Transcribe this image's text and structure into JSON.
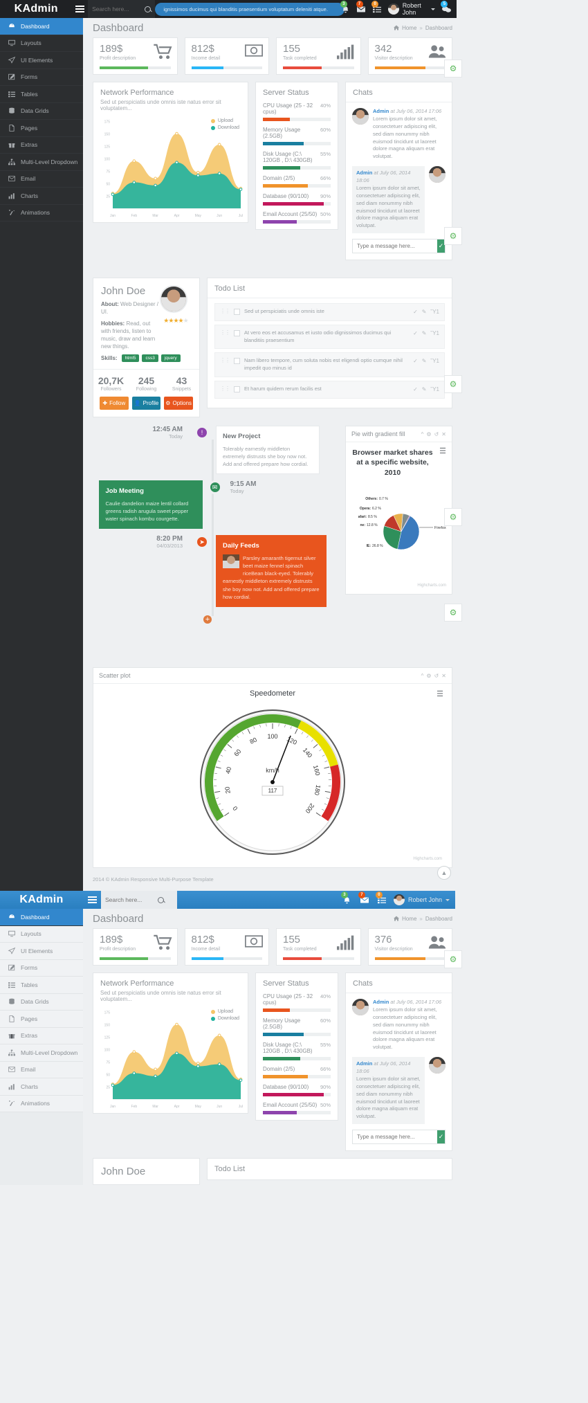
{
  "header": {
    "brand": "KAdmin",
    "search_placeholder": "Search here...",
    "ticker_text": "ignissimos ducimus qui blanditis praesentium voluptatum deleniti atque.",
    "bell_badge": "3",
    "mail_badge": "7",
    "tasks_badge": "0",
    "chat_badge": "5",
    "user_name": "Robert John"
  },
  "sidebar": {
    "items": [
      {
        "label": "Dashboard",
        "icon": "dashboard-icon",
        "active": true
      },
      {
        "label": "Layouts",
        "icon": "monitor-icon",
        "active": false
      },
      {
        "label": "UI Elements",
        "icon": "paper-plane-icon",
        "active": false
      },
      {
        "label": "Forms",
        "icon": "edit-icon",
        "active": false
      },
      {
        "label": "Tables",
        "icon": "table-icon",
        "active": false
      },
      {
        "label": "Data Grids",
        "icon": "database-icon",
        "active": false
      },
      {
        "label": "Pages",
        "icon": "file-icon",
        "active": false
      },
      {
        "label": "Extras",
        "icon": "gift-icon",
        "active": false
      },
      {
        "label": "Multi-Level Dropdown",
        "icon": "sitemap-icon",
        "active": false
      },
      {
        "label": "Email",
        "icon": "envelope-icon",
        "active": false
      },
      {
        "label": "Charts",
        "icon": "chart-icon",
        "active": false
      },
      {
        "label": "Animations",
        "icon": "magic-icon",
        "active": false
      }
    ]
  },
  "page": {
    "title": "Dashboard",
    "breadcrumb_home": "Home",
    "breadcrumb_sep": "»",
    "breadcrumb_current": "Dashboard"
  },
  "stats": [
    {
      "value": "189$",
      "label": "Profit description",
      "icon": "cart-icon",
      "bar_color": "#5cb85c",
      "bar_pct": "68"
    },
    {
      "value": "812$",
      "label": "Income detail",
      "icon": "money-icon",
      "bar_color": "#29b6f6",
      "bar_pct": "45"
    },
    {
      "value": "155",
      "label": "Task completed",
      "icon": "bars-icon",
      "bar_color": "#e84c3d",
      "bar_pct": "55"
    },
    {
      "value": "342",
      "label": "Visitor description",
      "icon": "users-icon",
      "bar_color": "#f0932b",
      "bar_pct": "72"
    }
  ],
  "stats_second": [
    {
      "value": "189$",
      "label": "Profit description",
      "icon": "cart-icon",
      "bar_color": "#5cb85c",
      "bar_pct": "68"
    },
    {
      "value": "812$",
      "label": "Income detail",
      "icon": "money-icon",
      "bar_color": "#29b6f6",
      "bar_pct": "45"
    },
    {
      "value": "155",
      "label": "Task completed",
      "icon": "bars-icon",
      "bar_color": "#e84c3d",
      "bar_pct": "55"
    },
    {
      "value": "376",
      "label": "Visitor description",
      "icon": "users-icon",
      "bar_color": "#f0932b",
      "bar_pct": "72"
    }
  ],
  "network": {
    "title": "Network Performance",
    "subtitle": "Sed ut perspiciatis unde omnis iste natus error sit voluptatem...",
    "legend": [
      {
        "label": "Upload",
        "color": "#f4c568"
      },
      {
        "label": "Download",
        "color": "#21b2a0"
      }
    ]
  },
  "server_status": {
    "title": "Server Status",
    "rows": [
      {
        "label": "CPU Usage (25 - 32 cpus)",
        "pct": "40%",
        "value": 40,
        "color": "#e8551e"
      },
      {
        "label": "Memory Usage (2.5GB)",
        "pct": "60%",
        "value": 60,
        "color": "#1a7fa0"
      },
      {
        "label": "Disk Usage (C:\\ 120GB , D:\\ 430GB)",
        "pct": "55%",
        "value": 55,
        "color": "#2f8f5b"
      },
      {
        "label": "Domain (2/5)",
        "pct": "66%",
        "value": 66,
        "color": "#f0932b"
      },
      {
        "label": "Database (90/100)",
        "pct": "90%",
        "value": 90,
        "color": "#c2185b"
      },
      {
        "label": "Email Account (25/50)",
        "pct": "50%",
        "value": 50,
        "color": "#8e44ad"
      }
    ]
  },
  "chats": {
    "title": "Chats",
    "messages": [
      {
        "author": "Admin",
        "time": "at July 06, 2014 17:06",
        "text": "Lorem ipsum dolor sit amet, consectetuer adipiscing elit, sed diam nonummy nibh euismod tincidunt ut laoreet dolore magna aliquam erat volutpat.",
        "side": "left"
      },
      {
        "author": "Admin",
        "time": "at July 06, 2014 18:06",
        "text": "Lorem ipsum dolor sit amet, consectetuer adipiscing elit, sed diam nonummy nibh euismod tincidunt ut laoreet dolore magna aliquam erat volutpat.",
        "side": "right"
      }
    ],
    "input_placeholder": "Type a message here...",
    "send_icon": "check-icon"
  },
  "profile": {
    "name": "John Doe",
    "about_label": "About:",
    "about_value": "Web Designer / UI.",
    "hobbies_label": "Hobbies:",
    "hobbies_value": "Read, out with friends, listen to music, draw and learn new things.",
    "skills_label": "Skills:",
    "skills": [
      "html5",
      "css3",
      "jquery"
    ],
    "rating_filled": 4,
    "rating_total": 5,
    "stats": [
      {
        "number": "20,7K",
        "label": "Followers"
      },
      {
        "number": "245",
        "label": "Following"
      },
      {
        "number": "43",
        "label": "Snippets"
      }
    ],
    "buttons": [
      {
        "label": "Follow",
        "color": "#ef8a32",
        "icon": "plus-circle-icon"
      },
      {
        "label": "Profile",
        "color": "#1a7fa0",
        "icon": "user-icon"
      },
      {
        "label": "Options",
        "color": "#e8551e",
        "icon": "cog-circle-icon"
      }
    ]
  },
  "todo": {
    "title": "Todo List",
    "items": [
      "Sed ut perspiciatis unde omnis iste",
      "At vero eos et accusamus et iusto odio dignissimos ducimus qui blanditiis praesentium",
      "Nam libero tempore, cum soluta nobis est eligendi optio cumque nihil impedit quo minus id",
      "Et harum quidem rerum facilis est"
    ],
    "action_icons": [
      "check-icon",
      "edit-icon",
      "trash-icon"
    ]
  },
  "timeline": [
    {
      "time": "12:45 AM",
      "day": "Today",
      "dot_color": "#8e44ad",
      "dot_icon": "!",
      "card_style": "white",
      "title": "New Project",
      "text": "Tolerably earnestly middleton extremely distrusts she boy now not. Add and offered prepare how cordial."
    },
    {
      "time": "9:15 AM",
      "day": "Today",
      "dot_color": "#2f8f5b",
      "dot_icon": "✉",
      "card_style": "green",
      "title": "Job Meeting",
      "text": "Caulie dandelion maize lentil collard greens radish arugula sweet pepper water spinach kombu courgette."
    },
    {
      "time": "8:20 PM",
      "day": "04/03/2013",
      "dot_color": "#e8551e",
      "dot_icon": "➤",
      "card_style": "red",
      "title": "Daily Feeds",
      "text": "Parsley amaranth tigernut silver beet maize fennel spinach riceBean black-eyed. Tolerably earnestly middleton extremely distrusts she boy now not. Add and offered prepare how cordial."
    }
  ],
  "pie_panel": {
    "header": "Pie with gradient fill",
    "header_actions": [
      "collapse-icon",
      "settings-icon",
      "refresh-icon",
      "close-icon"
    ],
    "credits": "Highcharts.com",
    "menu_icon": "hamburger-menu-icon"
  },
  "scatter_panel": {
    "header": "Scatter plot",
    "header_actions": [
      "collapse-icon",
      "settings-icon",
      "refresh-icon",
      "close-icon"
    ],
    "credits": "Highcharts.com",
    "menu_icon": "hamburger-menu-icon"
  },
  "footer": "2014 © KAdmin Responsive Multi-Purpose Template",
  "chart_data": [
    {
      "type": "area",
      "title": "Network Performance",
      "subtitle": "Sed ut perspiciatis unde omnis iste natus error sit voluptatem...",
      "categories": [
        "Jan",
        "Feb",
        "Mar",
        "Apr",
        "May",
        "Jun",
        "Jul"
      ],
      "xlabel": "",
      "ylabel": "",
      "ylim": [
        0,
        175
      ],
      "yticks": [
        25,
        50,
        75,
        100,
        125,
        150,
        175
      ],
      "grid": false,
      "legend_position": "top-right",
      "series": [
        {
          "name": "Upload",
          "color": "#f4c568",
          "values": [
            30,
            95,
            60,
            150,
            72,
            128,
            40
          ]
        },
        {
          "name": "Download",
          "color": "#21b2a0",
          "values": [
            28,
            52,
            46,
            92,
            66,
            70,
            38
          ]
        }
      ]
    },
    {
      "type": "pie",
      "title": "Browser market shares at a specific website, 2010",
      "credits": "Highcharts.com",
      "legend_position": "none",
      "labels": [
        "Firefox",
        "IE",
        "Chrome",
        "Safari",
        "Opera",
        "Others"
      ],
      "values": [
        45.0,
        26.8,
        12.8,
        8.5,
        6.2,
        0.7
      ],
      "value_labels": [
        "Firefox",
        "IE: 26.8 %",
        "ne: 12.8 %",
        "afari: 8.5 %",
        "Opera: 6.2 %",
        "Others: 0.7 %"
      ],
      "colors": [
        "#3a7abd",
        "#2f8f5b",
        "#c0392b",
        "#e8b04b",
        "#7f8c8d",
        "#8e44ad"
      ]
    },
    {
      "type": "gauge",
      "title": "Speedometer",
      "unit": "km/h",
      "value": 117,
      "min": 0,
      "max": 200,
      "ticks": [
        0,
        20,
        40,
        60,
        80,
        100,
        120,
        140,
        160,
        180,
        200
      ],
      "bands": [
        {
          "from": 0,
          "to": 120,
          "color": "#55a630"
        },
        {
          "from": 120,
          "to": 160,
          "color": "#e8e000"
        },
        {
          "from": 160,
          "to": 200,
          "color": "#d62828"
        }
      ],
      "credits": "Highcharts.com"
    }
  ]
}
